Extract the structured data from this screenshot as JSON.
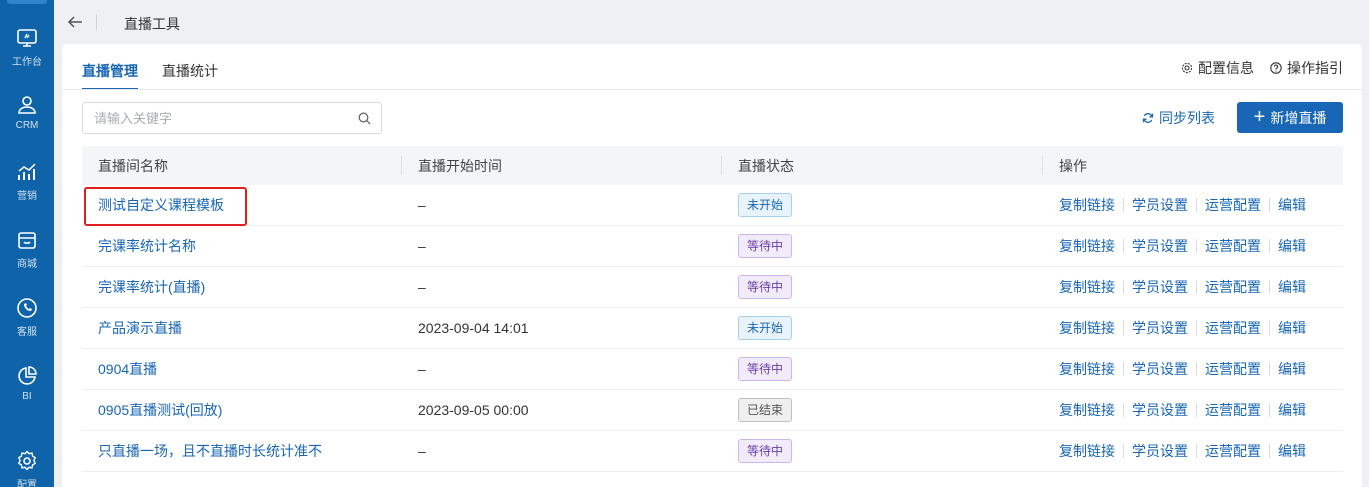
{
  "sidebar": {
    "items": [
      {
        "label": "工作台",
        "icon": "dashboard-icon"
      },
      {
        "label": "CRM",
        "icon": "user-icon"
      },
      {
        "label": "营销",
        "icon": "chart-icon"
      },
      {
        "label": "商城",
        "icon": "store-icon"
      },
      {
        "label": "客服",
        "icon": "phone-icon"
      },
      {
        "label": "BI",
        "icon": "pie-chart-icon"
      },
      {
        "label": "配置",
        "icon": "gear-icon"
      }
    ]
  },
  "header": {
    "title": "直播工具"
  },
  "tabs": [
    {
      "label": "直播管理",
      "active": true
    },
    {
      "label": "直播统计",
      "active": false
    }
  ],
  "top_links": {
    "config": "配置信息",
    "guide": "操作指引"
  },
  "search": {
    "placeholder": "请输入关键字"
  },
  "actions": {
    "sync": "同步列表",
    "add": "新增直播"
  },
  "table": {
    "headers": [
      "直播间名称",
      "直播开始时间",
      "直播状态",
      "操作"
    ],
    "rows": [
      {
        "name": "测试自定义课程模板",
        "time": "–",
        "status": "未开始",
        "status_type": "notstarted"
      },
      {
        "name": "完课率统计名称",
        "time": "–",
        "status": "等待中",
        "status_type": "waiting"
      },
      {
        "name": "完课率统计(直播)",
        "time": "–",
        "status": "等待中",
        "status_type": "waiting"
      },
      {
        "name": "产品演示直播",
        "time": "2023-09-04 14:01",
        "status": "未开始",
        "status_type": "notstarted"
      },
      {
        "name": "0904直播",
        "time": "–",
        "status": "等待中",
        "status_type": "waiting"
      },
      {
        "name": "0905直播测试(回放)",
        "time": "2023-09-05 00:00",
        "status": "已结束",
        "status_type": "ended"
      },
      {
        "name": "只直播一场，且不直播时长统计准不",
        "time": "–",
        "status": "等待中",
        "status_type": "waiting"
      }
    ],
    "ops": [
      "复制链接",
      "学员设置",
      "运营配置",
      "编辑"
    ]
  }
}
